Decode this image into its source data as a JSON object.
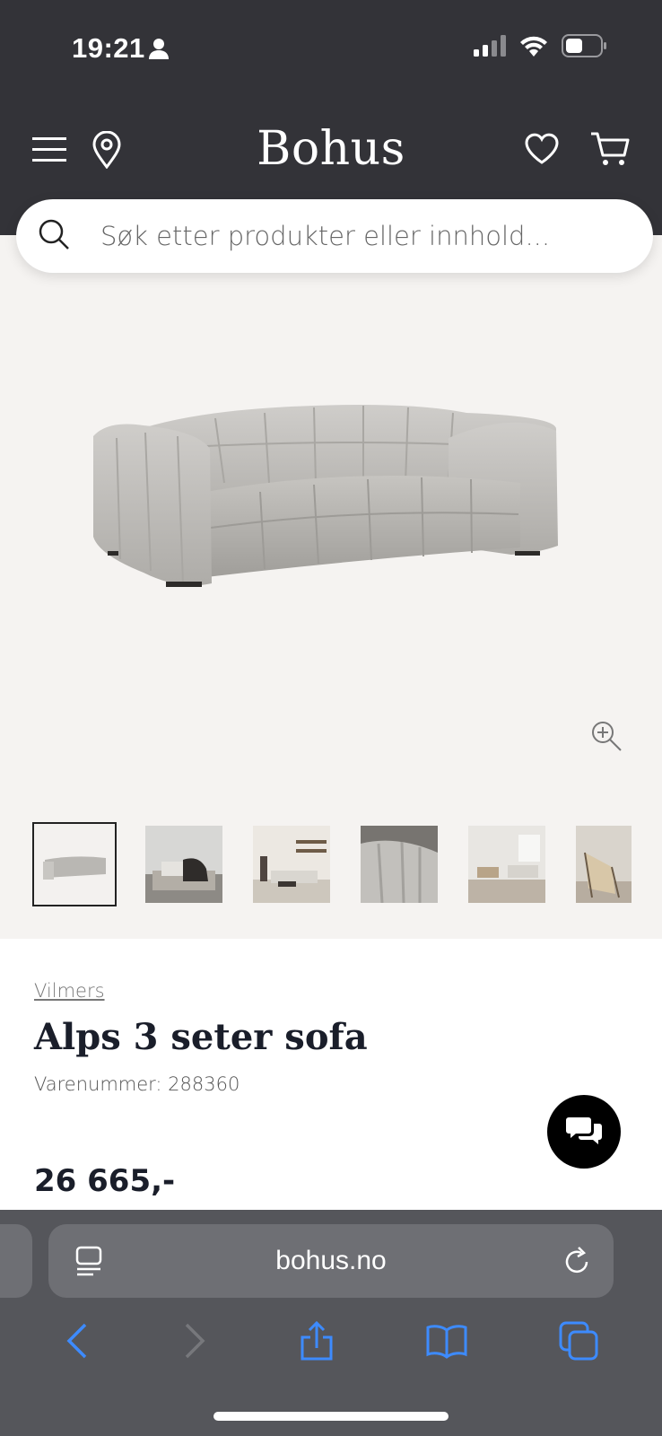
{
  "status_bar": {
    "time": "19:21"
  },
  "header": {
    "logo": "Bohus"
  },
  "search": {
    "placeholder": "Søk etter produkter eller innhold..."
  },
  "product": {
    "brand": "Vilmers",
    "title": "Alps 3 seter sofa",
    "sku_label": "Varenummer: 288360",
    "price": "26 665,-"
  },
  "browser": {
    "url": "bohus.no"
  },
  "icons": {
    "header": [
      "menu-icon",
      "location-pin-icon",
      "heart-icon",
      "cart-icon"
    ],
    "toolbar": [
      "back-icon",
      "forward-icon",
      "share-icon",
      "bookmarks-icon",
      "tabs-icon"
    ]
  },
  "colors": {
    "header_bg": "#333338",
    "accent": "#3d8bff",
    "page_bg": "#f5f3f1"
  }
}
